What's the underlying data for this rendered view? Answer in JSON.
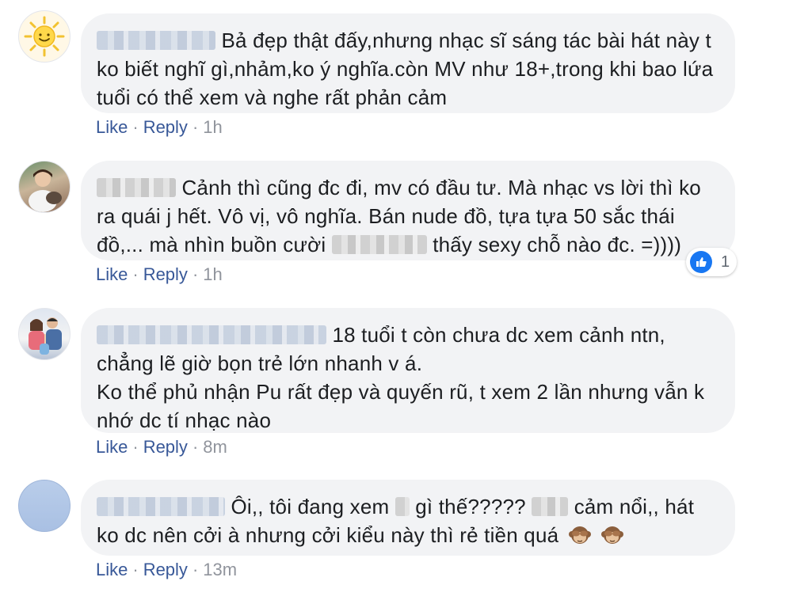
{
  "comments": [
    {
      "text_parts": [
        "Bả đẹp thật đấy,nhưng nhạc sĩ sáng tác bài hát này t ko biết nghĩ gì,nhảm,ko ý nghĩa.còn MV như 18+,trong khi bao lứa tuổi có thể xem và nghe rất phản cảm"
      ],
      "like_label": "Like",
      "reply_label": "Reply",
      "time": "1h"
    },
    {
      "text_parts": [
        "Cảnh thì cũng đc đi, mv có đầu tư. Mà nhạc vs lời thì ko ra quái j hết. Vô vị, vô nghĩa. Bán nude đồ, tựa tựa 50 sắc thái đồ,... mà nhìn buồn cười",
        "thấy sexy chỗ nào đc. =))))"
      ],
      "like_label": "Like",
      "reply_label": "Reply",
      "time": "1h",
      "reaction_count": "1"
    },
    {
      "text_parts": [
        "18 tuổi t còn chưa dc xem cảnh ntn,",
        "chẳng lẽ giờ bọn trẻ lớn nhanh v á.",
        "Ko thể phủ nhận Pu rất đẹp và quyến rũ, t xem 2 lần nhưng vẫn k nhớ dc tí nhạc nào"
      ],
      "like_label": "Like",
      "reply_label": "Reply",
      "time": "8m"
    },
    {
      "text_parts": [
        "Ôi,, tôi đang xem",
        "gì thế?????",
        "cảm nổi,, hát ko dc nên cởi à nhưng cởi kiểu này thì rẻ tiền quá"
      ],
      "like_label": "Like",
      "reply_label": "Reply",
      "time": "13m",
      "emojis": [
        "see-no-evil-monkey-icon",
        "see-no-evil-monkey-icon"
      ]
    }
  ],
  "colors": {
    "bubble": "#f2f3f5",
    "link": "#385898",
    "meta": "#90949c",
    "like_blue": "#1877f2"
  }
}
